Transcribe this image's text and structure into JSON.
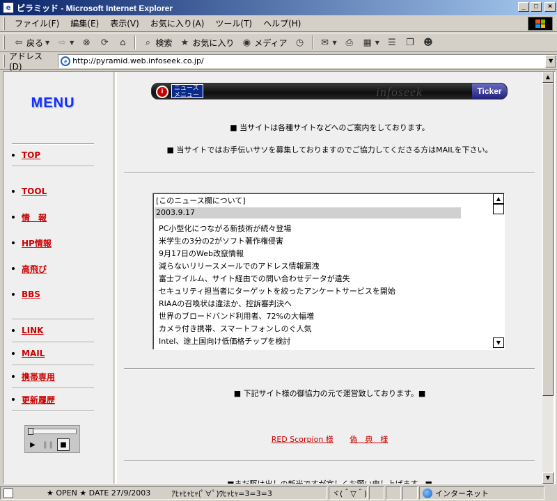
{
  "window": {
    "title": "ピラミッド - Microsoft Internet Explorer",
    "controls": {
      "minimize": "_",
      "maximize": "□",
      "close": "×"
    }
  },
  "menubar": {
    "items": [
      "ファイル(F)",
      "編集(E)",
      "表示(V)",
      "お気に入り(A)",
      "ツール(T)",
      "ヘルプ(H)"
    ]
  },
  "toolbar": {
    "back": "戻る",
    "search": "検索",
    "favorites": "お気に入り",
    "media": "メディア",
    "icons": [
      "back-icon",
      "forward-icon",
      "stop-icon",
      "refresh-icon",
      "home-icon",
      "search-icon",
      "favorites-icon",
      "media-icon",
      "history-icon",
      "mail-icon",
      "print-icon",
      "edit-icon",
      "discuss-icon",
      "messenger-icon"
    ]
  },
  "addressbar": {
    "label": "アドレス(D)",
    "url": "http://pyramid.web.infoseek.co.jp/"
  },
  "left": {
    "menu_title": "MENU",
    "nav": [
      "TOP",
      "TOOL",
      "情　報",
      "HP情報",
      "高飛び",
      "BBS",
      "LINK",
      "MAIL",
      "携帯専用",
      "更新履歴"
    ]
  },
  "ticker": {
    "logo": "i",
    "news_label_1": "ニュース",
    "news_label_2": "メニュー",
    "brand": "infoseek",
    "ticker_label": "Ticker"
  },
  "main": {
    "notice_1": "■ 当サイトは各種サイトなどへのご案内をしております。",
    "notice_2": "■ 当サイトではお手伝いサソを募集しておりますのでご協力してくださる方はMAILを下さい。",
    "news_header": "[このニュース欄について]",
    "news_date": "2003.9.17",
    "news_items": [
      "PC小型化につながる新技術が続々登場",
      "米学生の3分の2がソフト著作権侵害",
      "9月17日のWeb改竄情報",
      "減らないリリースメールでのアドレス情報漏洩",
      "富士フイルム、サイト経由での問い合わせデータが遺失",
      "セキュリティ担当者にターゲットを絞ったアンケートサービスを開始",
      "RIAAの召喚状は違法か、控訴審判決へ",
      "世界のブロードバンド利用者、72%の大幅増",
      "カメラ付き携帯、スマートフォンしのぐ人気",
      "Intel、途上国向け低価格チップを検討"
    ],
    "cooperation": "■ 下記サイト様の御協力の元で運営致しております。■",
    "link_1": "RED Scorpion 様",
    "link_2": "偽　典　様",
    "bottom_text": "■まだ駆け出しの新米ですが宜しくお願い申し上げます。■"
  },
  "statusbar": {
    "marquee": "★ OPEN ★ DATE 27/9/2003",
    "face": "ｱﾋｬﾋｬﾋｬ(ﾟ∀ﾟ)ｳﾋｬﾋｬ=3=3=3",
    "face2": "ヾ(＾▽＾)ノ",
    "zone": "インターネット"
  }
}
